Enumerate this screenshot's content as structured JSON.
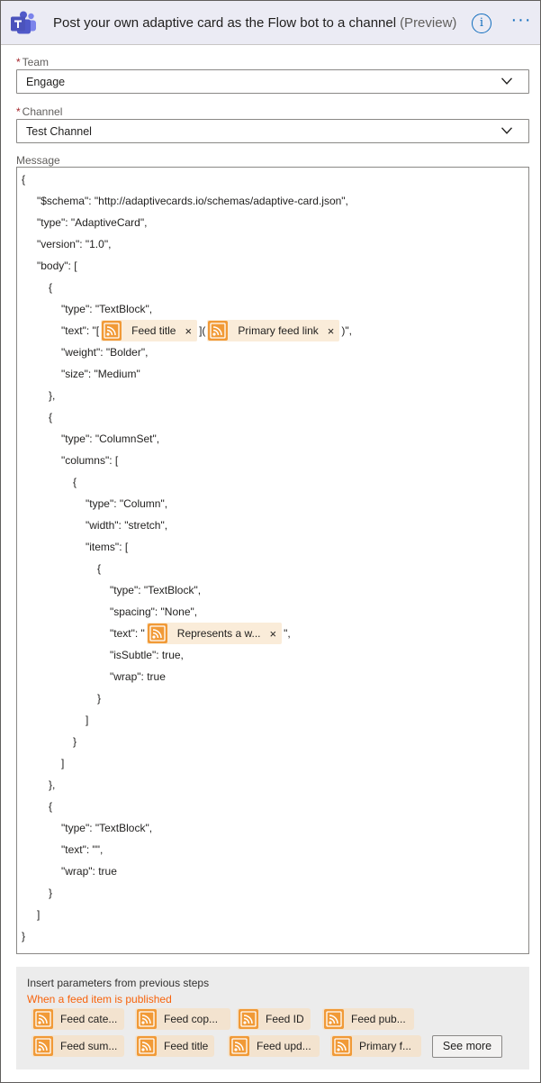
{
  "header": {
    "title": "Post your own adaptive card as the Flow bot to a channel",
    "preview": "(Preview)",
    "info_icon": "i",
    "more_icon": "···"
  },
  "fields": {
    "team": {
      "required": "*",
      "label": "Team",
      "value": "Engage"
    },
    "channel": {
      "required": "*",
      "label": "Channel",
      "value": "Test Channel"
    },
    "message_label": "Message"
  },
  "editor_lines": [
    {
      "text": "{"
    },
    {
      "text": "\"$schema\": \"http://adaptivecards.io/schemas/adaptive-card.json\","
    },
    {
      "text": "\"type\": \"AdaptiveCard\","
    },
    {
      "text": "\"version\": \"1.0\","
    },
    {
      "text": "\"body\": ["
    },
    {
      "text": "{"
    },
    {
      "text": "\"type\": \"TextBlock\","
    },
    {
      "pre": "\"text\": \"[",
      "token1": "Feed title",
      "mid": "](",
      "token2": "Primary feed link",
      "post": ")\","
    },
    {
      "text": "\"weight\": \"Bolder\","
    },
    {
      "text": "\"size\": \"Medium\""
    },
    {
      "text": "},"
    },
    {
      "text": "{"
    },
    {
      "text": "\"type\": \"ColumnSet\","
    },
    {
      "text": "\"columns\": ["
    },
    {
      "text": "{"
    },
    {
      "text": "\"type\": \"Column\","
    },
    {
      "text": "\"width\": \"stretch\","
    },
    {
      "text": "\"items\": ["
    },
    {
      "text": "{"
    },
    {
      "text": "\"type\": \"TextBlock\","
    },
    {
      "text": "\"spacing\": \"None\","
    },
    {
      "pre": "\"text\": \"",
      "token1": "Represents a w...",
      "post": "\","
    },
    {
      "text": "\"isSubtle\": true,"
    },
    {
      "text": "\"wrap\": true"
    },
    {
      "text": "}"
    },
    {
      "text": "]"
    },
    {
      "text": "}"
    },
    {
      "text": "]"
    },
    {
      "text": "},"
    },
    {
      "text": "{"
    },
    {
      "text": "\"type\": \"TextBlock\","
    },
    {
      "text": "\"text\": \"\","
    },
    {
      "text": "\"wrap\": true"
    },
    {
      "text": "}"
    },
    {
      "text": "]"
    },
    {
      "text": "}"
    }
  ],
  "token_close": "×",
  "panel": {
    "heading": "Insert parameters from previous steps",
    "subheading": "When a feed item is published",
    "chips": [
      "Feed cate...",
      "Feed cop...",
      "Feed ID",
      "Feed pub...",
      "Feed sum...",
      "Feed title",
      "Feed upd...",
      "Primary f..."
    ],
    "see_more": "See more"
  },
  "colors": {
    "header_bg": "#ebebf4",
    "accent": "#0f6cbd",
    "rss_orange": "#f19a37",
    "token_bg": "#faecd9",
    "required": "#a4262c",
    "subheading": "#f7630c"
  },
  "icons": {
    "app": "microsoft-teams-icon",
    "info": "info-icon",
    "more": "more-icon",
    "chevron": "chevron-down-icon",
    "rss": "rss-icon"
  }
}
